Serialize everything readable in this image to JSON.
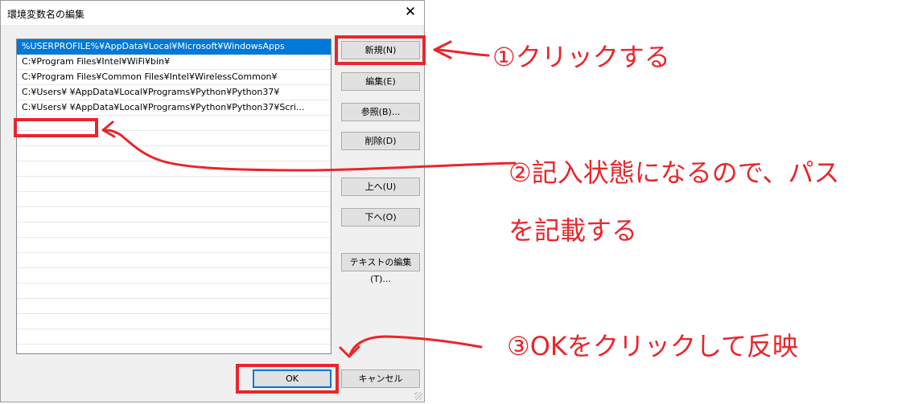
{
  "window": {
    "title": "環境変数名の編集",
    "close_glyph": "✕"
  },
  "path_list": [
    "%USERPROFILE%¥AppData¥Local¥Microsoft¥WindowsApps",
    "C:¥Program Files¥Intel¥WiFi¥bin¥",
    "C:¥Program Files¥Common Files¥Intel¥WirelessCommon¥",
    "C:¥Users¥               ¥AppData¥Local¥Programs¥Python¥Python37¥",
    "C:¥Users¥               ¥AppData¥Local¥Programs¥Python¥Python37¥Scri...",
    "",
    "",
    "",
    "",
    "",
    "",
    "",
    "",
    "",
    "",
    "",
    "",
    "",
    "",
    "",
    ""
  ],
  "buttons": {
    "new": "新規(N)",
    "edit": "編集(E)",
    "browse": "参照(B)...",
    "delete": "削除(D)",
    "move_up": "上へ(U)",
    "move_down": "下へ(O)",
    "edit_text": "テキストの編集(T)...",
    "ok": "OK",
    "cancel": "キャンセル"
  },
  "annotations": {
    "step1": "①クリックする",
    "step2_line1": "②記入状態になるので、パス",
    "step2_line2": "を記載する",
    "step3": "③OKをクリックして反映"
  },
  "colors": {
    "annotation": "#e8262b",
    "selection": "#0078d7"
  }
}
